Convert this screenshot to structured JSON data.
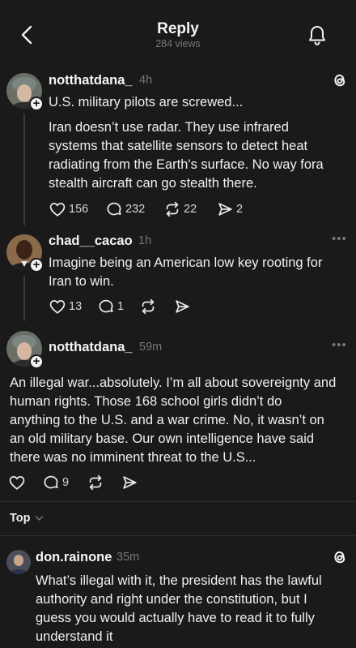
{
  "header": {
    "title": "Reply",
    "views": "284 views"
  },
  "posts": [
    {
      "username": "notthatdana_",
      "time": "4h",
      "lines": [
        "U.S. military pilots are screwed...",
        "",
        "Iran doesn’t use radar. They use infrared",
        "systems that satellite sensors to detect heat",
        "radiating from the Earth's surface. No way fora",
        "stealth aircraft can go stealth there."
      ],
      "likes": "156",
      "comments": "232",
      "reposts": "22",
      "shares": "2"
    },
    {
      "username": "chad__cacao",
      "time": "1h",
      "lines": [
        "Imagine being an American low key rooting for",
        "Iran to win."
      ],
      "likes": "13",
      "comments": "1"
    },
    {
      "username": "notthatdana_",
      "time": "59m",
      "lines": [
        "An illegal war...absolutely. I’m all about sovereignty and",
        "human rights. Those 168 school girls didn’t do",
        "anything to the U.S. and a war crime. No, it wasn’t on",
        "an old military base. Our own intelligence have said",
        "there was no imminent threat to the U.S..."
      ],
      "comments": "9"
    },
    {
      "username": "don.rainone",
      "time": "35m",
      "lines": [
        "What’s illegal with it, the president has the lawful",
        "authority and right under the constitution, but I",
        "guess you would actually have to read it to fully",
        "understand it"
      ]
    }
  ],
  "sort": {
    "label": "Top"
  },
  "more_menu": "•••"
}
